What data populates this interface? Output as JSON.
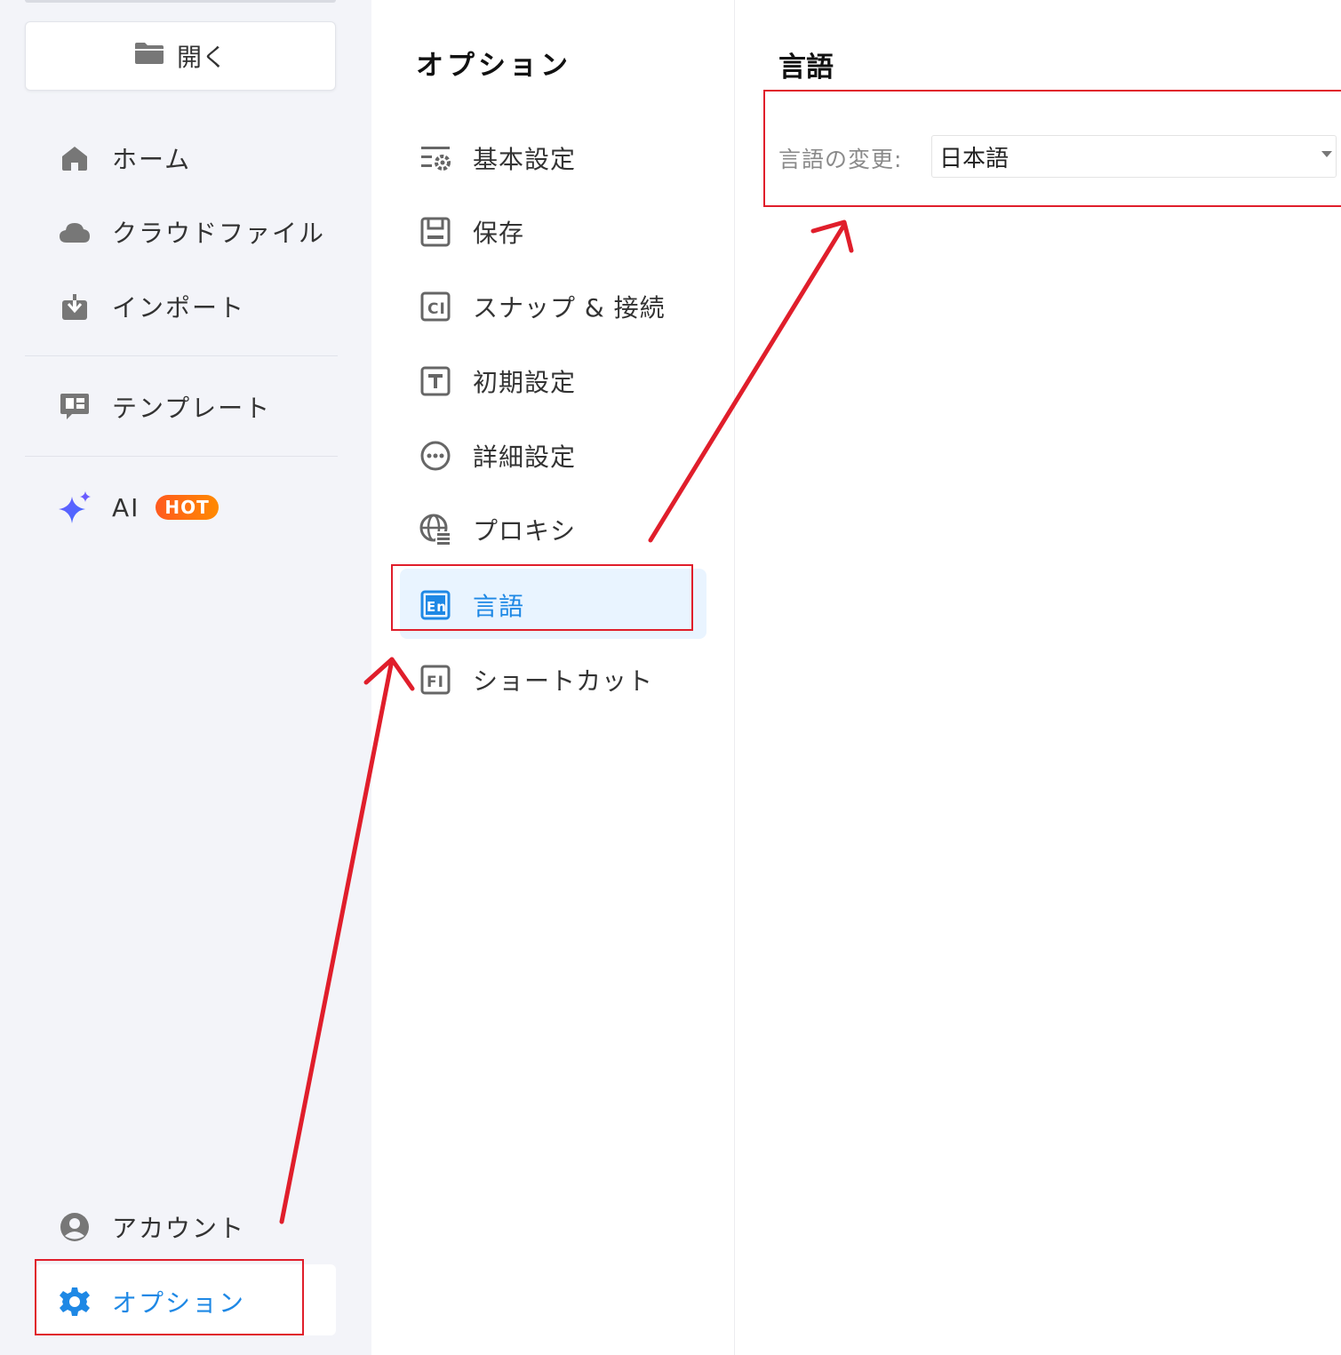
{
  "sidebar": {
    "open_label": "開く",
    "items": [
      {
        "label": "ホーム",
        "icon": "home-icon"
      },
      {
        "label": "クラウドファイル",
        "icon": "cloud-icon"
      },
      {
        "label": "インポート",
        "icon": "import-icon"
      },
      {
        "label": "テンプレート",
        "icon": "template-icon"
      },
      {
        "label": "AI",
        "icon": "ai-sparkle-icon",
        "badge": "HOT"
      }
    ],
    "account_label": "アカウント",
    "options_label": "オプション"
  },
  "options": {
    "title": "オプション",
    "items": [
      {
        "label": "基本設定",
        "icon": "basic-settings-icon"
      },
      {
        "label": "保存",
        "icon": "save-icon"
      },
      {
        "label": "スナップ & 接続",
        "icon": "snap-connect-icon"
      },
      {
        "label": "初期設定",
        "icon": "text-default-icon"
      },
      {
        "label": "詳細設定",
        "icon": "more-dots-icon"
      },
      {
        "label": "プロキシ",
        "icon": "proxy-globe-icon"
      },
      {
        "label": "言語",
        "icon": "language-icon",
        "selected": true
      },
      {
        "label": "ショートカット",
        "icon": "shortcut-icon"
      }
    ]
  },
  "language": {
    "title": "言語",
    "change_label": "言語の変更:",
    "selected_value": "日本語"
  },
  "colors": {
    "accent": "#1e88e5",
    "annotation_red": "#e01e2b",
    "sidebar_bg": "#f3f4f9",
    "selected_bg": "#e9f4ff",
    "hot_badge": "#ff6a10"
  }
}
